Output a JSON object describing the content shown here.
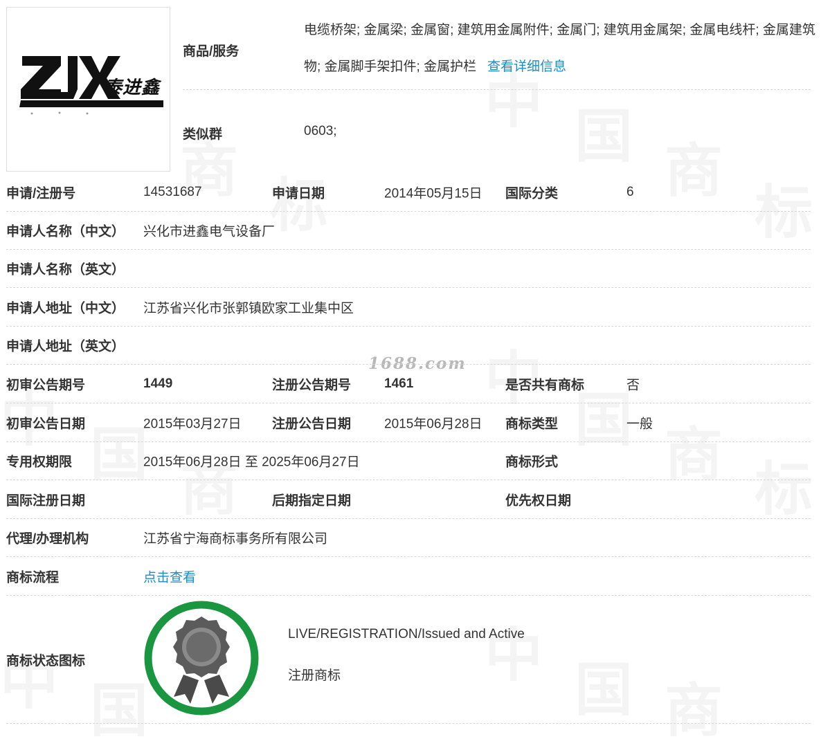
{
  "logo": {
    "text": "泰进鑫"
  },
  "goods": {
    "label": "商品/服务",
    "value": "电缆桥架; 金属梁; 金属窗; 建筑用金属附件; 金属门; 建筑用金属架; 金属电线杆; 金属建筑物; 金属脚手架扣件; 金属护栏",
    "detail_link": "查看详细信息"
  },
  "similar_group": {
    "label": "类似群",
    "value": "0603;"
  },
  "application": {
    "reg_no_label": "申请/注册号",
    "reg_no": "14531687",
    "date_label": "申请日期",
    "date": "2014年05月15日",
    "class_label": "国际分类",
    "class": "6"
  },
  "applicant_name_cn": {
    "label": "申请人名称（中文）",
    "value": "兴化市进鑫电气设备厂"
  },
  "applicant_name_en": {
    "label": "申请人名称（英文）",
    "value": ""
  },
  "applicant_addr_cn": {
    "label": "申请人地址（中文）",
    "value": "江苏省兴化市张郭镇欧家工业集中区"
  },
  "applicant_addr_en": {
    "label": "申请人地址（英文）",
    "value": ""
  },
  "announcement_no": {
    "prelim_label": "初审公告期号",
    "prelim": "1449",
    "reg_label": "注册公告期号",
    "reg": "1461",
    "shared_label": "是否共有商标",
    "shared": "否"
  },
  "announcement_date": {
    "prelim_label": "初审公告日期",
    "prelim": "2015年03月27日",
    "reg_label": "注册公告日期",
    "reg": "2015年06月28日",
    "type_label": "商标类型",
    "type": "一般"
  },
  "exclusive": {
    "label": "专用权期限",
    "value": "2015年06月28日 至 2025年06月27日",
    "form_label": "商标形式",
    "form": ""
  },
  "intl": {
    "reg_date_label": "国际注册日期",
    "reg_date": "",
    "later_label": "后期指定日期",
    "later": "",
    "priority_label": "优先权日期",
    "priority": ""
  },
  "agency": {
    "label": "代理/办理机构",
    "value": "江苏省宁海商标事务所有限公司"
  },
  "process": {
    "label": "商标流程",
    "link": "点击查看"
  },
  "status": {
    "label": "商标状态图标",
    "en": "LIVE/REGISTRATION/Issued and Active",
    "cn": "注册商标",
    "ring_color": "#1a9641"
  },
  "watermark": {
    "site": "1688.com",
    "chars": [
      "中",
      "国",
      "商",
      "标"
    ]
  }
}
